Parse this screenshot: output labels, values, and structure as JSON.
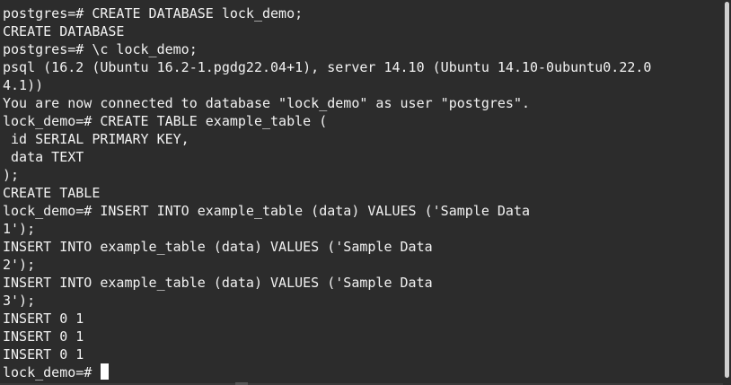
{
  "terminal": {
    "lines": [
      "postgres=# CREATE DATABASE lock_demo;",
      "CREATE DATABASE",
      "postgres=# \\c lock_demo;",
      "psql (16.2 (Ubuntu 16.2-1.pgdg22.04+1), server 14.10 (Ubuntu 14.10-0ubuntu0.22.0",
      "4.1))",
      "You are now connected to database \"lock_demo\" as user \"postgres\".",
      "lock_demo=# CREATE TABLE example_table (",
      " id SERIAL PRIMARY KEY,",
      " data TEXT",
      ");",
      "CREATE TABLE",
      "lock_demo=# INSERT INTO example_table (data) VALUES ('Sample Data",
      "1');",
      "INSERT INTO example_table (data) VALUES ('Sample Data",
      "2');",
      "INSERT INTO example_table (data) VALUES ('Sample Data",
      "3');",
      "INSERT 0 1",
      "INSERT 0 1",
      "INSERT 0 1"
    ],
    "prompt": "lock_demo=# "
  },
  "colors": {
    "background": "#2c2c2c",
    "foreground": "#f2f2f2",
    "cursor": "#ffffff",
    "scrollbar_thumb": "#cfcfcf"
  }
}
